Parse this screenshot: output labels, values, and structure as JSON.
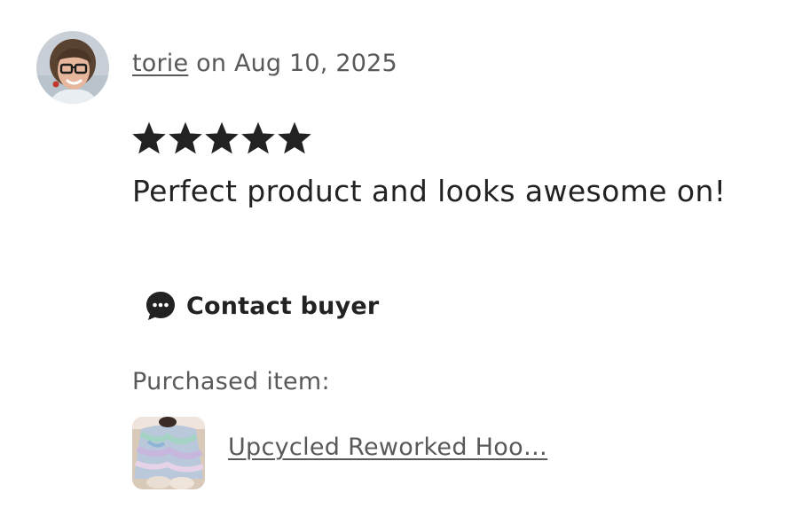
{
  "review": {
    "reviewer_name": "torie",
    "date_prefix": " on ",
    "date": "Aug 10, 2025",
    "rating": 5,
    "rating_max": 5,
    "text": "Perfect product and looks awesome on!",
    "contact_label": "Contact buyer",
    "purchased_label": "Purchased item:",
    "item_title": "Upcycled Reworked Hoo…"
  },
  "icons": {
    "avatar": "avatar",
    "star": "star-icon",
    "chat": "chat-bubble-icon",
    "thumbnail": "item-thumbnail"
  },
  "colors": {
    "text_primary": "#222222",
    "text_secondary": "#595959",
    "star": "#222222"
  }
}
